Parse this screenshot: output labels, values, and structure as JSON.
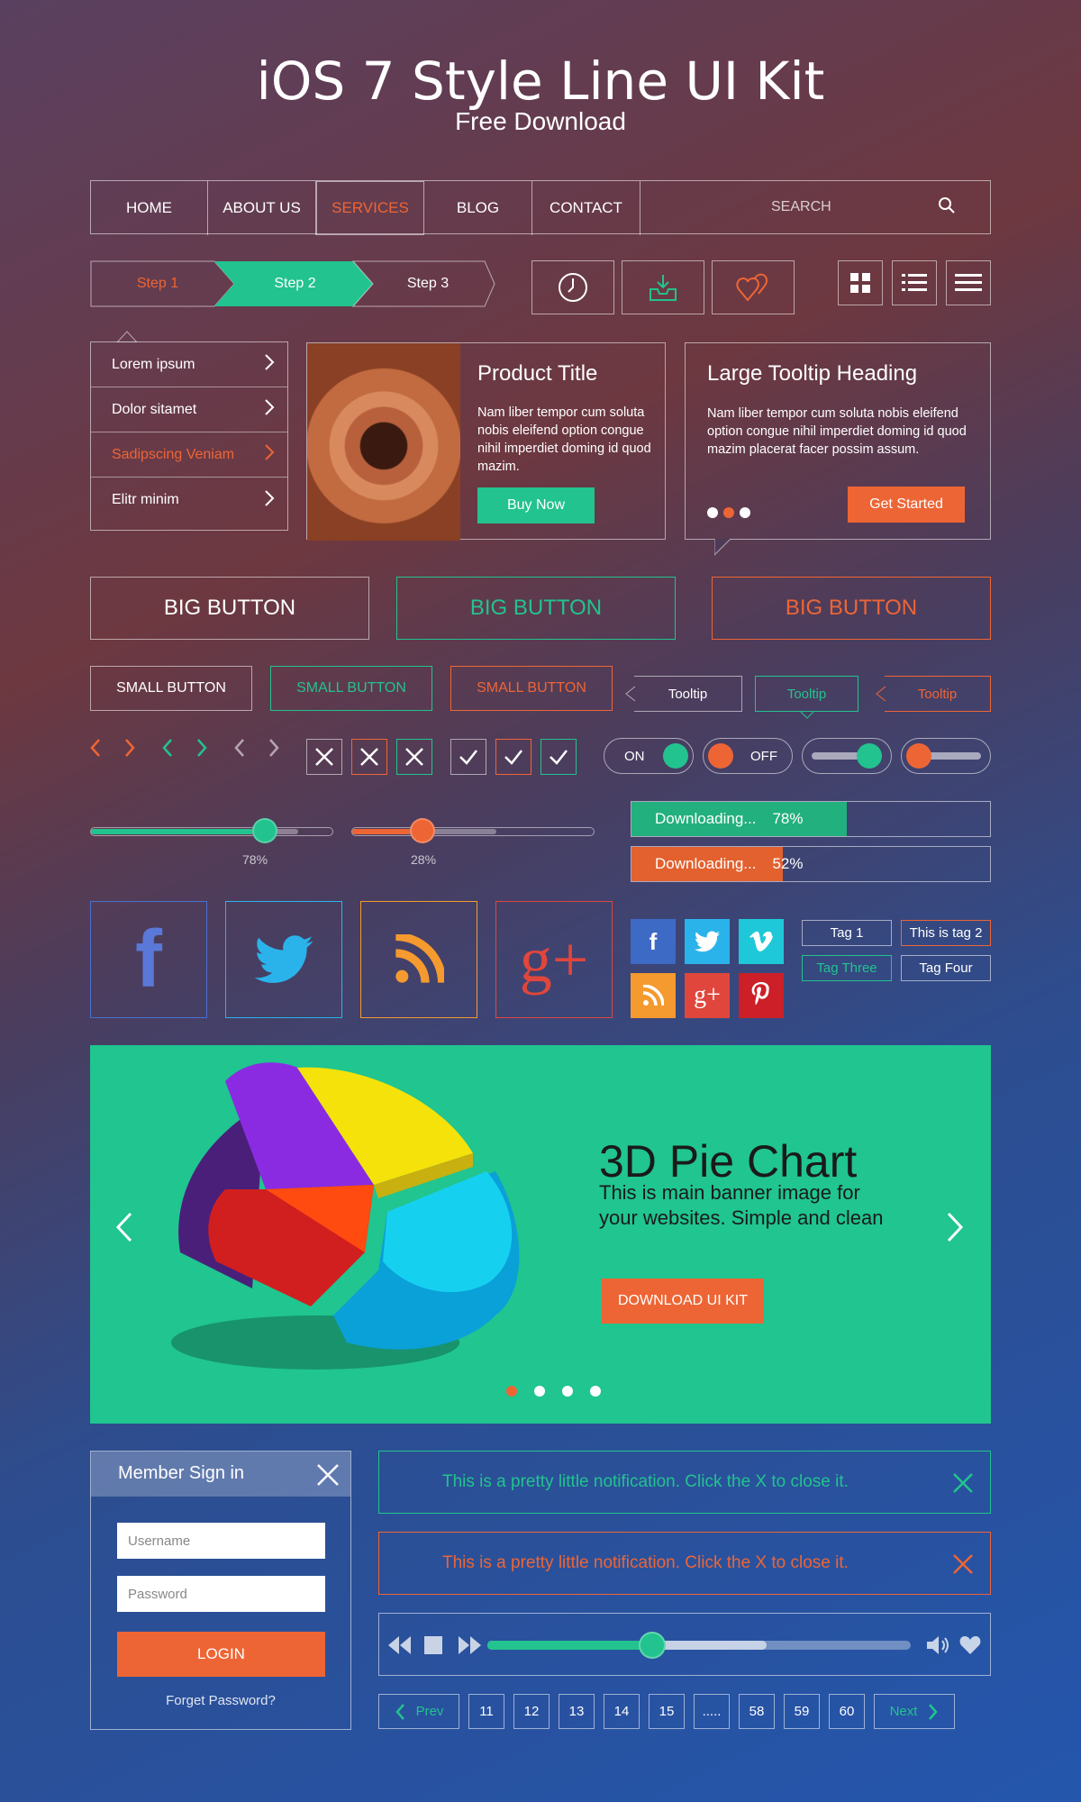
{
  "header": {
    "title": "iOS 7 Style Line UI Kit",
    "subtitle": "Free Download"
  },
  "nav": {
    "items": [
      "HOME",
      "ABOUT US",
      "SERVICES",
      "BLOG",
      "CONTACT"
    ],
    "active": "SERVICES",
    "search_placeholder": "SEARCH"
  },
  "steps": [
    "Step 1",
    "Step 2",
    "Step 3"
  ],
  "icons": {
    "clock": "clock-icon",
    "inbox": "inbox-download-icon",
    "hearts": "hearts-icon",
    "grid": "grid-icon",
    "list": "list-icon",
    "menu": "menu-icon"
  },
  "menu": [
    "Lorem ipsum",
    "Dolor sitamet",
    "Sadipscing Veniam",
    "Elitr minim"
  ],
  "product": {
    "title": "Product Title",
    "text": "Nam liber tempor cum soluta nobis eleifend option congue nihil imperdiet doming id quod mazim.",
    "button": "Buy Now"
  },
  "tooltip_card": {
    "title": "Large Tooltip Heading",
    "text": "Nam liber tempor cum soluta nobis eleifend option congue nihil imperdiet doming id quod mazim placerat facer possim assum.",
    "button": "Get Started"
  },
  "big_buttons": [
    "BIG BUTTON",
    "BIG BUTTON",
    "BIG BUTTON"
  ],
  "small_buttons": [
    "SMALL BUTTON",
    "SMALL BUTTON",
    "SMALL BUTTON"
  ],
  "tooltips": [
    "Tooltip",
    "Tooltip",
    "Tooltip"
  ],
  "toggles": {
    "on": "ON",
    "off": "OFF"
  },
  "sliders": [
    {
      "value": 0.78,
      "label": "78%"
    },
    {
      "value": 0.28,
      "label": "28%"
    }
  ],
  "downloads": [
    {
      "label": "Downloading...",
      "percent": "78%",
      "value": 0.78,
      "color": "#22b07e"
    },
    {
      "label": "Downloading...",
      "percent": "52%",
      "value": 0.52,
      "color": "#e2612f"
    }
  ],
  "social": {
    "facebook": "f",
    "google": "g+"
  },
  "tags": [
    "Tag 1",
    "This is tag 2",
    "Tag Three",
    "Tag Four"
  ],
  "banner": {
    "title": "3D Pie Chart",
    "text": "This is main banner image for your websites. Simple and clean",
    "button": "DOWNLOAD UI KIT"
  },
  "signin": {
    "title": "Member Sign in",
    "username_placeholder": "Username",
    "password_placeholder": "Password",
    "login": "LOGIN",
    "forgot": "Forget Password?"
  },
  "notifications": [
    "This is a pretty little notification. Click the X to close it.",
    "This is a pretty little notification. Click the X to close it."
  ],
  "player": {
    "progress": 0.39,
    "buffered": 0.66
  },
  "pager": {
    "prev": "Prev",
    "next": "Next",
    "pages": [
      "11",
      "12",
      "13",
      "14",
      "15",
      ".....",
      "58",
      "59",
      "60"
    ]
  },
  "colors": {
    "green": "#22c38e",
    "orange": "#ee6535"
  }
}
